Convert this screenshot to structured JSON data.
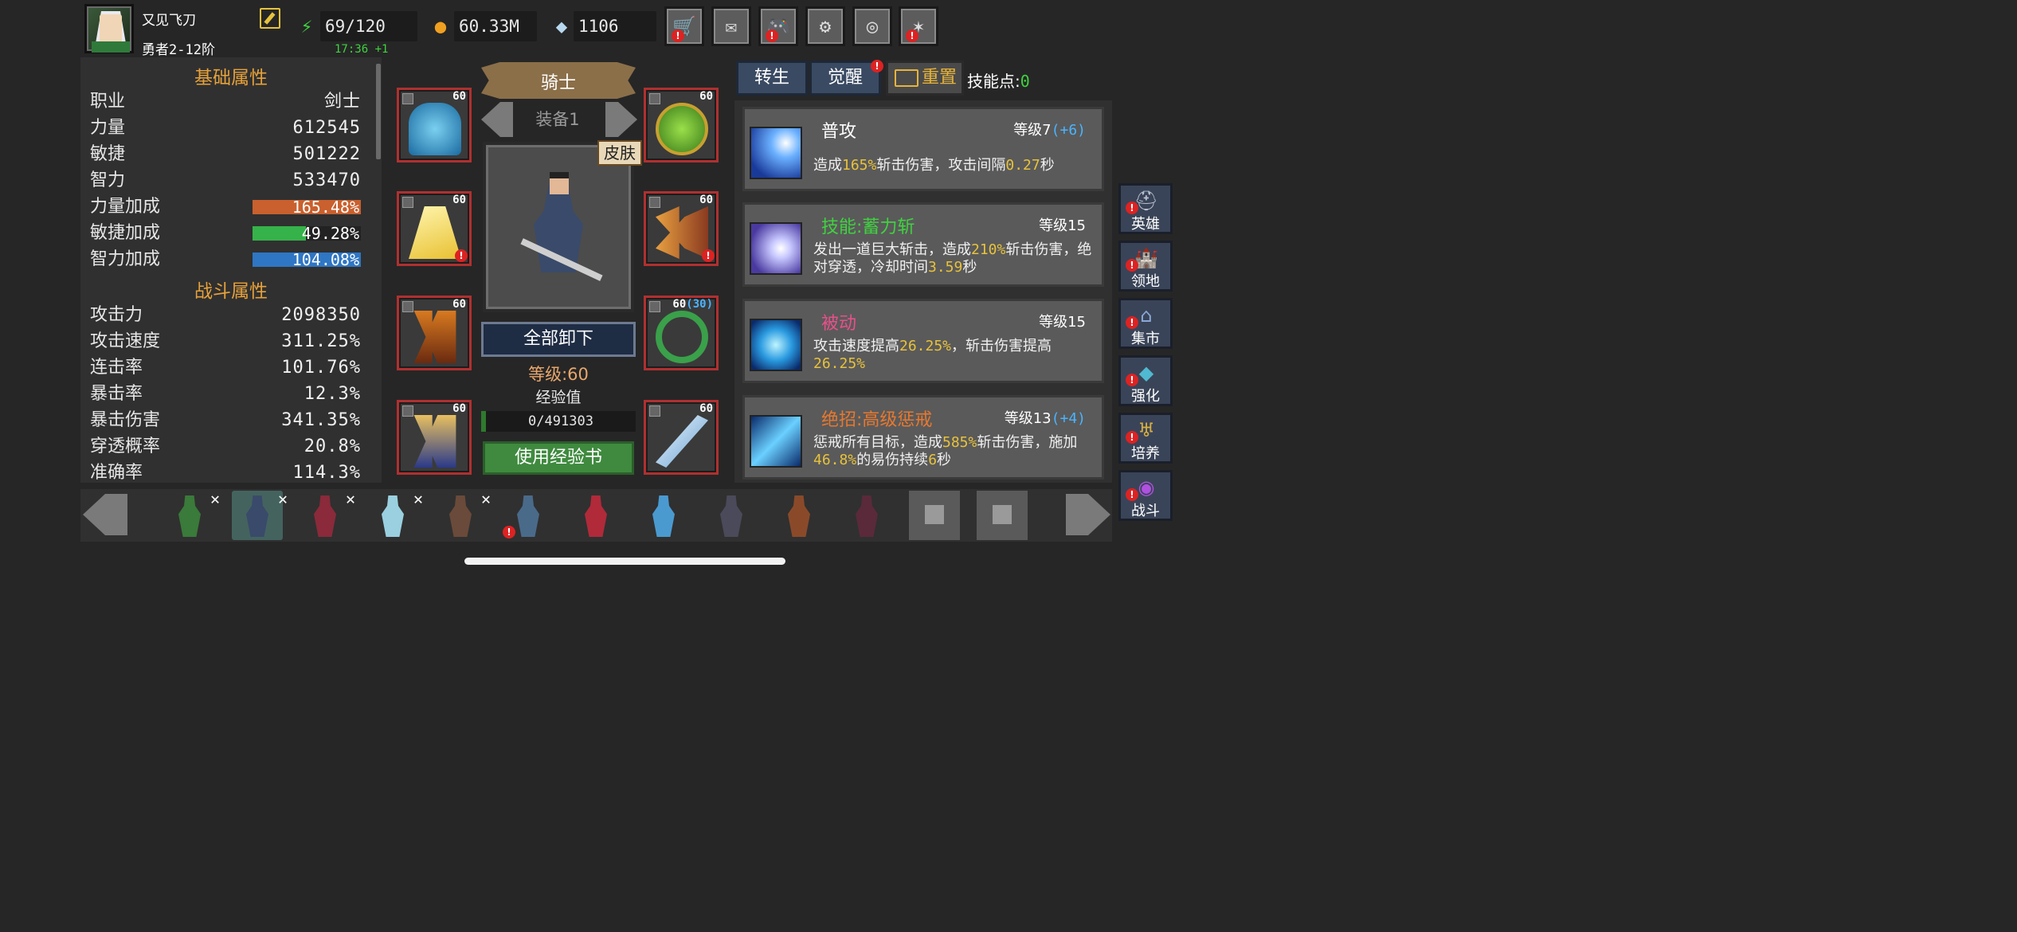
{
  "player": {
    "name": "又见飞刀",
    "rank": "勇者2-12阶"
  },
  "resources": {
    "stamina": "69/120",
    "regen": "17:36 +1",
    "gold": "60.33M",
    "diamonds": "1106"
  },
  "top_buttons": [
    {
      "name": "shop",
      "icon": "🛒",
      "alert": true
    },
    {
      "name": "mail",
      "icon": "✉",
      "alert": false
    },
    {
      "name": "gamepad",
      "icon": "🎮",
      "alert": true
    },
    {
      "name": "settings",
      "icon": "⚙",
      "alert": false
    },
    {
      "name": "gacha",
      "icon": "◎",
      "alert": false
    },
    {
      "name": "fireworks",
      "icon": "✶",
      "alert": true
    }
  ],
  "basic": {
    "title": "基础属性",
    "rows": [
      {
        "label": "职业",
        "value": "剑士"
      },
      {
        "label": "力量",
        "value": "612545"
      },
      {
        "label": "敏捷",
        "value": "501222"
      },
      {
        "label": "智力",
        "value": "533470"
      }
    ],
    "bonus_rows": [
      {
        "label": "力量加成",
        "value": "165.48%",
        "color": "#c9602e"
      },
      {
        "label": "敏捷加成",
        "value": "49.28%",
        "color": "#36b24a"
      },
      {
        "label": "智力加成",
        "value": "104.08%",
        "color": "#2f76c4"
      }
    ]
  },
  "combat": {
    "title": "战斗属性",
    "rows": [
      {
        "label": "攻击力",
        "value": "2098350"
      },
      {
        "label": "攻击速度",
        "value": "311.25%"
      },
      {
        "label": "连击率",
        "value": "101.76%"
      },
      {
        "label": "暴击率",
        "value": "12.3%"
      },
      {
        "label": "暴击伤害",
        "value": "341.35%"
      },
      {
        "label": "穿透概率",
        "value": "20.8%"
      },
      {
        "label": "准确率",
        "value": "114.3%"
      }
    ]
  },
  "equipment": {
    "class_title": "骑士",
    "set_label": "装备1",
    "skin_label": "皮肤",
    "unequip_label": "全部卸下",
    "level_text": "等级:60",
    "exp_label": "经验值",
    "exp_value": "0/491303",
    "use_exp_label": "使用经验书",
    "slots": [
      {
        "name": "helmet",
        "level": "60",
        "extra": ""
      },
      {
        "name": "amulet",
        "level": "60",
        "extra": ""
      },
      {
        "name": "cape",
        "level": "60",
        "extra": ""
      },
      {
        "name": "gloves",
        "level": "60",
        "extra": ""
      },
      {
        "name": "legs",
        "level": "60",
        "extra": ""
      },
      {
        "name": "ring",
        "level": "60",
        "extra": "(30)"
      },
      {
        "name": "boots",
        "level": "60",
        "extra": ""
      },
      {
        "name": "sword",
        "level": "60",
        "extra": ""
      }
    ]
  },
  "skills_header": {
    "tab_rebirth": "转生",
    "tab_awaken": "觉醒",
    "reset": "重置",
    "skill_points_label": "技能点:",
    "skill_points": "0"
  },
  "skills": [
    {
      "name": "普攻",
      "name_color": "#ffffff",
      "level": "等级7",
      "bonus": "(+6)",
      "desc": [
        [
          "造成",
          ""
        ],
        [
          "165%",
          "hl"
        ],
        [
          "斩击伤害，攻击间隔",
          ""
        ],
        [
          "0.27",
          "hl"
        ],
        [
          "秒",
          ""
        ]
      ]
    },
    {
      "name": "技能:蓄力斩",
      "name_color": "#3fd23f",
      "level": "等级15",
      "bonus": "",
      "desc": [
        [
          "发出一道巨大斩击，造成",
          ""
        ],
        [
          "210%",
          "hl"
        ],
        [
          "斩击伤害，绝对穿透，冷却时间",
          ""
        ],
        [
          "3.59",
          "hl"
        ],
        [
          "秒",
          ""
        ]
      ]
    },
    {
      "name": "被动",
      "name_color": "#e8508a",
      "level": "等级15",
      "bonus": "",
      "desc": [
        [
          "攻击速度提高",
          ""
        ],
        [
          "26.25%",
          "hl"
        ],
        [
          "，斩击伤害提高",
          ""
        ],
        [
          "26.25%",
          "hl"
        ]
      ]
    },
    {
      "name": "绝招:高级惩戒",
      "name_color": "#e8782e",
      "level": "等级13",
      "bonus": "(+4)",
      "desc": [
        [
          "惩戒所有目标，造成",
          ""
        ],
        [
          "585%",
          "hl"
        ],
        [
          "斩击伤害，施加",
          ""
        ],
        [
          "46.8%",
          "hl"
        ],
        [
          "的易伤持续",
          ""
        ],
        [
          "6",
          "hl"
        ],
        [
          "秒",
          ""
        ]
      ]
    }
  ],
  "side_nav": [
    {
      "label": "英雄",
      "icon": "⛑"
    },
    {
      "label": "领地",
      "icon": "🏰"
    },
    {
      "label": "集市",
      "icon": "⌂"
    },
    {
      "label": "强化",
      "icon": "◆"
    },
    {
      "label": "培养",
      "icon": "♅"
    },
    {
      "label": "战斗",
      "icon": "◉"
    }
  ],
  "heroes": [
    {
      "name": "archer",
      "color": "#3a7a3a",
      "removable": true,
      "selected": false,
      "locked": false
    },
    {
      "name": "knight",
      "color": "#3a4a6a",
      "removable": true,
      "selected": true,
      "locked": false
    },
    {
      "name": "mage",
      "color": "#8a2a3a",
      "removable": true,
      "selected": false,
      "locked": false
    },
    {
      "name": "spirit",
      "color": "#9ad0e0",
      "removable": true,
      "selected": false,
      "locked": false
    },
    {
      "name": "huntress",
      "color": "#6a4a3a",
      "removable": true,
      "selected": false,
      "locked": false
    },
    {
      "name": "gunner",
      "color": "#4a6a8a",
      "removable": false,
      "selected": false,
      "locked": false
    },
    {
      "name": "sorceress",
      "color": "#b02a3a",
      "removable": false,
      "selected": false,
      "locked": false
    },
    {
      "name": "ice-spirit",
      "color": "#4a9ad0",
      "removable": false,
      "selected": false,
      "locked": false
    },
    {
      "name": "warlock",
      "color": "#4a4a5a",
      "removable": false,
      "selected": false,
      "locked": false
    },
    {
      "name": "rogue",
      "color": "#8a4a2a",
      "removable": false,
      "selected": false,
      "locked": false
    },
    {
      "name": "dark-knight",
      "color": "#5a2a3a",
      "removable": false,
      "selected": false,
      "locked": false
    },
    {
      "name": "locked-1",
      "color": "#5a5a5a",
      "removable": false,
      "selected": false,
      "locked": true
    },
    {
      "name": "locked-2",
      "color": "#5a5a5a",
      "removable": false,
      "selected": false,
      "locked": true
    }
  ]
}
